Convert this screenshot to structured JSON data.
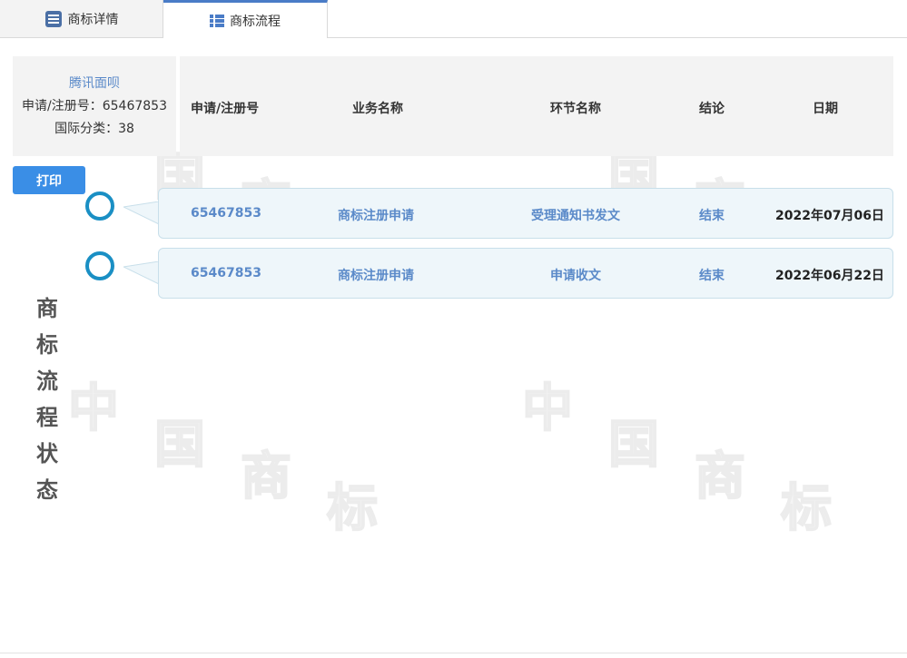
{
  "tabs": [
    {
      "label": "商标详情",
      "icon": "document-list-icon",
      "active": false
    },
    {
      "label": "商标流程",
      "icon": "list-icon",
      "active": true
    }
  ],
  "info": {
    "trademark_name": "腾讯面呗",
    "reg_label": "申请/注册号：65467853",
    "class_label": "国际分类：38"
  },
  "table_header": {
    "reg_no": "申请/注册号",
    "business": "业务名称",
    "node": "环节名称",
    "result": "结论",
    "date": "日期"
  },
  "print_label": "打印",
  "side_title": [
    "商",
    "标",
    "流",
    "程",
    "状",
    "态"
  ],
  "rows": [
    {
      "reg_no": "65467853",
      "business": "商标注册申请",
      "node": "受理通知书发文",
      "result": "结束",
      "date": "2022年07月06日"
    },
    {
      "reg_no": "65467853",
      "business": "商标注册申请",
      "node": "申请收文",
      "result": "结束",
      "date": "2022年06月22日"
    }
  ],
  "watermark": [
    "中",
    "国",
    "商",
    "标"
  ],
  "colors": {
    "accent": "#3a8ee6",
    "link": "#5b8ac9",
    "timeline": "#1a8fc4",
    "row_bg": "#eef6fa"
  }
}
